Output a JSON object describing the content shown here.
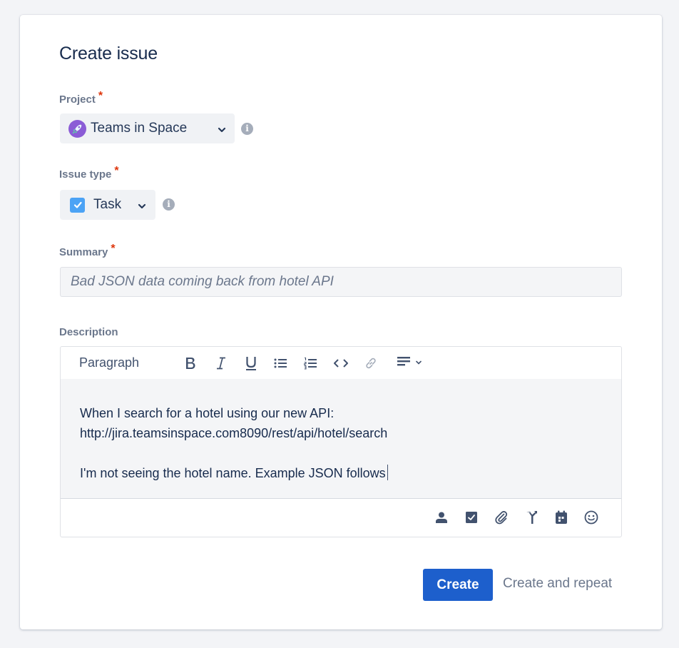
{
  "dialog": {
    "title": "Create issue"
  },
  "project": {
    "label": "Project",
    "required_mark": "*",
    "value": "Teams in Space",
    "avatar_icon": "rocket-avatar-icon",
    "info_glyph": "i"
  },
  "issue_type": {
    "label": "Issue type",
    "required_mark": "*",
    "value": "Task",
    "type_icon": "task-checkbox-icon",
    "info_glyph": "i"
  },
  "summary": {
    "label": "Summary",
    "required_mark": "*",
    "placeholder": "Bad JSON data coming back from hotel API"
  },
  "description": {
    "label": "Description",
    "toolbar": {
      "paragraph_style": "Paragraph",
      "buttons": [
        "bold-icon",
        "italic-icon",
        "underline-icon",
        "bullet-list-icon",
        "numbered-list-icon",
        "code-icon",
        "link-icon",
        "align-icon"
      ]
    },
    "lines": [
      "When I search for a hotel using our new API:",
      "http://jira.teamsinspace.com8090/rest/api/hotel/search",
      "",
      "I'm not seeing the hotel name. Example JSON follows"
    ],
    "footer_icons": [
      "mention-icon",
      "action-item-icon",
      "attachment-icon",
      "decision-icon",
      "date-icon",
      "emoji-icon"
    ]
  },
  "actions": {
    "create": "Create",
    "create_and_repeat": "Create and repeat"
  },
  "colors": {
    "primary": "#1d5fcc",
    "required": "#de350b",
    "background": "#f3f4f7"
  }
}
